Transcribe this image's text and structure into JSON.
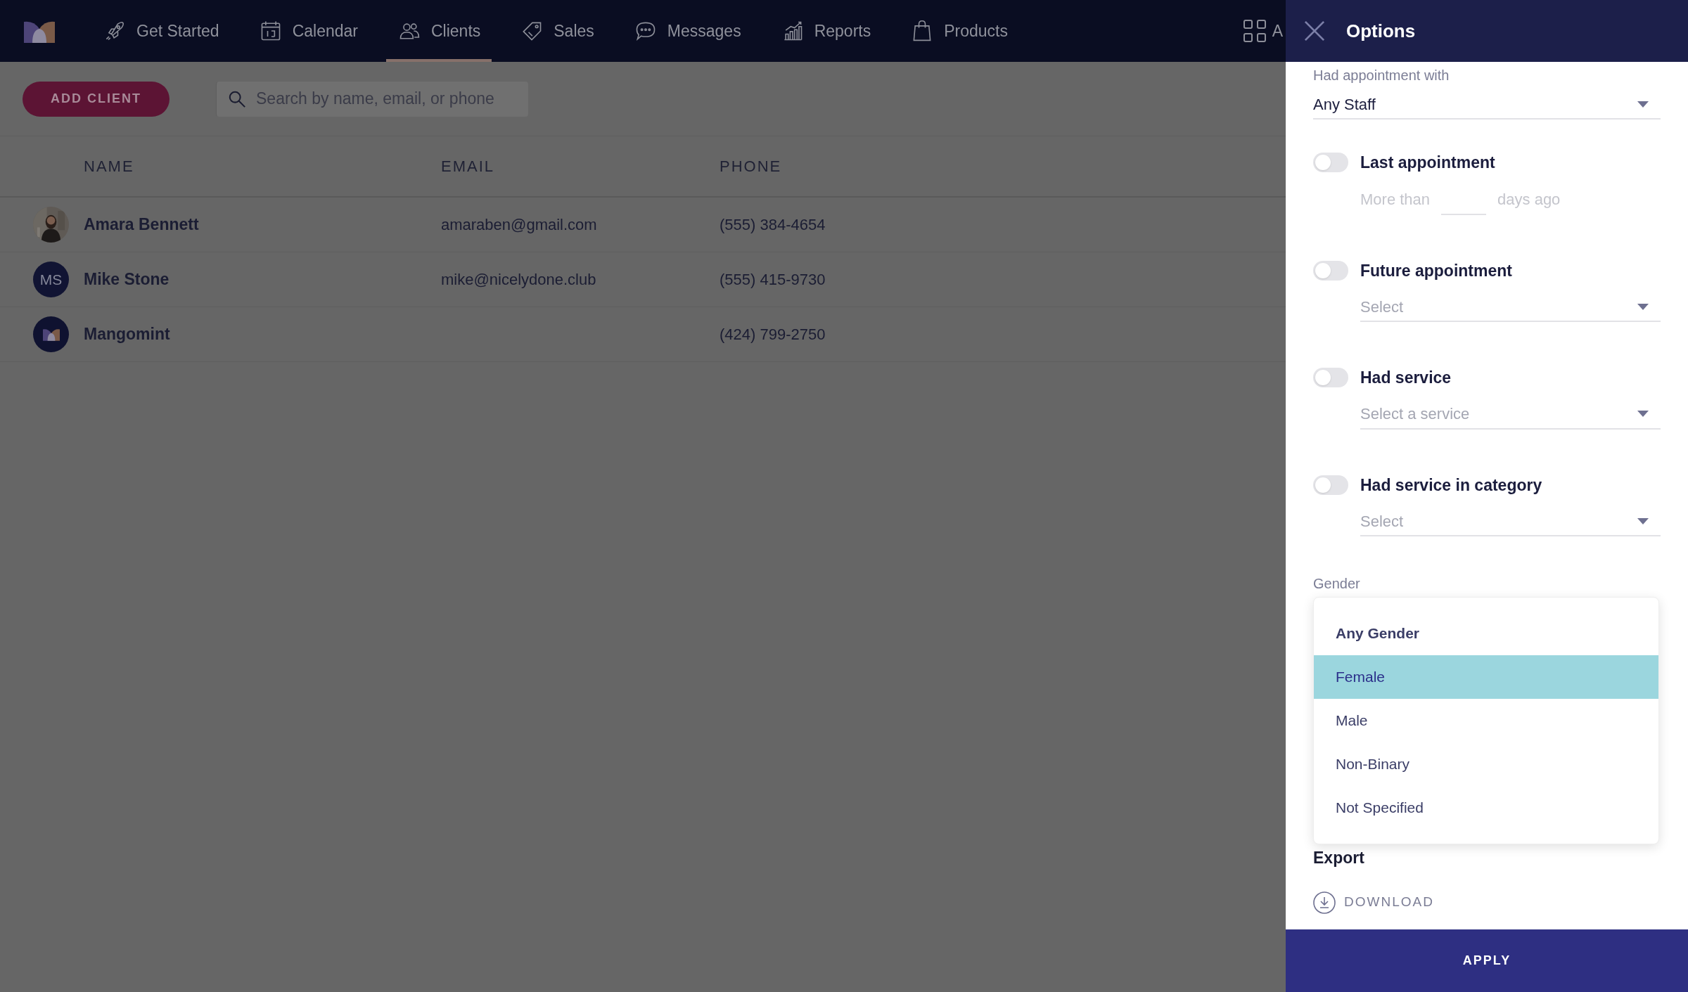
{
  "nav": {
    "items": [
      {
        "label": "Get Started",
        "selected": false
      },
      {
        "label": "Calendar",
        "selected": false
      },
      {
        "label": "Clients",
        "selected": true
      },
      {
        "label": "Sales",
        "selected": false
      },
      {
        "label": "Messages",
        "selected": false
      },
      {
        "label": "Reports",
        "selected": false
      },
      {
        "label": "Products",
        "selected": false
      }
    ],
    "apps_label": "A"
  },
  "toolbar": {
    "add_button": "ADD CLIENT",
    "search": {
      "placeholder": "Search by name, email, or phone"
    }
  },
  "table": {
    "columns": [
      "NAME",
      "EMAIL",
      "PHONE"
    ],
    "rows": [
      {
        "name": "Amara Bennett",
        "email": "amaraben@gmail.com",
        "phone": "(555) 384-4654"
      },
      {
        "avatar": {
          "kind": "initials",
          "text": "MS"
        },
        "name": "Mike Stone",
        "email": "mike@nicelydone.club",
        "phone": "(555) 415-9730"
      },
      {
        "avatar": {
          "kind": "logo"
        },
        "name": "Mangomint",
        "phone": "(424) 799-2750"
      }
    ]
  },
  "panel": {
    "title": "Options",
    "staff_filter": {
      "label": "Had appointment with",
      "value": "Any Staff"
    },
    "filters": [
      {
        "kind": "days",
        "label": "Last appointment",
        "on": false,
        "prefix": "More than",
        "suffix": "days ago"
      },
      {
        "kind": "select",
        "label": "Future appointment",
        "on": false,
        "placeholder": "Select"
      },
      {
        "kind": "select",
        "label": "Had service",
        "on": false,
        "placeholder": "Select a service"
      },
      {
        "kind": "select",
        "label": "Had service in category",
        "on": false,
        "placeholder": "Select"
      }
    ],
    "gender": {
      "label": "Gender",
      "options": [
        {
          "label": "Any Gender",
          "current": true,
          "selected": false
        },
        {
          "label": "Female",
          "current": false,
          "selected": true
        },
        {
          "label": "Male",
          "current": false,
          "selected": false
        },
        {
          "label": "Non-Binary",
          "current": false,
          "selected": false
        },
        {
          "label": "Not Specified",
          "current": false,
          "selected": false
        }
      ]
    },
    "export": {
      "title": "Export",
      "download": "DOWNLOAD"
    },
    "apply": "APPLY"
  }
}
